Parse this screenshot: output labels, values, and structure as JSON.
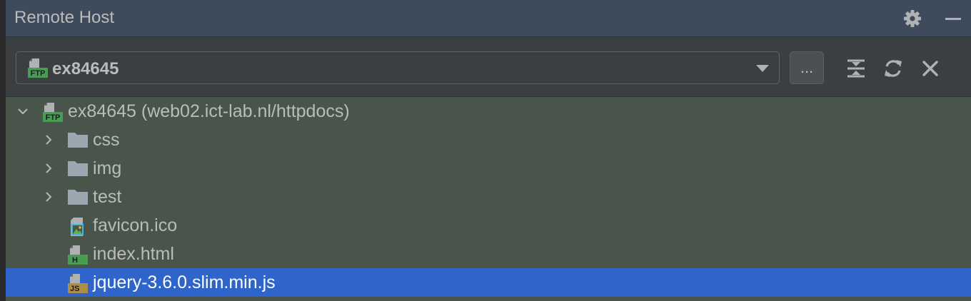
{
  "panel": {
    "title": "Remote Host"
  },
  "toolbar": {
    "server_selected": "ex84645",
    "browse_label": "..."
  },
  "tree": {
    "root_label": "ex84645 (web02.ict-lab.nl/httpdocs)",
    "items": [
      {
        "label": "css",
        "type": "folder"
      },
      {
        "label": "img",
        "type": "folder"
      },
      {
        "label": "test",
        "type": "folder"
      },
      {
        "label": "favicon.ico",
        "type": "image-file"
      },
      {
        "label": "index.html",
        "type": "html-file"
      },
      {
        "label": "jquery-3.6.0.slim.min.js",
        "type": "js-file",
        "selected": true
      }
    ]
  },
  "badges": {
    "ftp": "FTP",
    "html": "H",
    "js": "JS"
  },
  "colors": {
    "header_bg": "#3d4b5c",
    "toolbar_bg": "#3c3f41",
    "tree_bg": "#49544a",
    "selection": "#2f65ca",
    "ftp_badge": "#499c54",
    "js_badge": "#b08c4a"
  }
}
